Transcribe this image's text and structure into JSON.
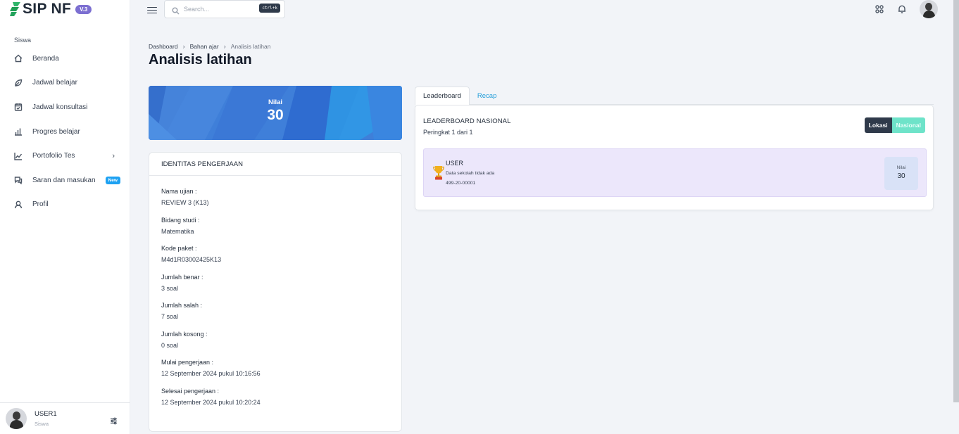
{
  "app": {
    "name": "SIP NF",
    "version_badge": "V.3"
  },
  "sidebar": {
    "section_label": "Siswa",
    "items": [
      {
        "label": "Beranda",
        "icon": "home-icon"
      },
      {
        "label": "Jadwal belajar",
        "icon": "leaf-icon"
      },
      {
        "label": "Jadwal konsultasi",
        "icon": "calendar-check-icon"
      },
      {
        "label": "Progres belajar",
        "icon": "bar-chart-icon"
      },
      {
        "label": "Portofolio Tes",
        "icon": "line-chart-icon",
        "chevron": "›"
      },
      {
        "label": "Saran dan masukan",
        "icon": "chat-icon",
        "badge": "New"
      },
      {
        "label": "Profil",
        "icon": "user-icon"
      }
    ],
    "footer": {
      "user_name": "USER1",
      "user_role": "Siswa"
    }
  },
  "topbar": {
    "search_placeholder": "Search...",
    "shortcut": "ctrl+k"
  },
  "breadcrumb": {
    "items": [
      "Dashboard",
      "Bahan ajar",
      "Analisis latihan"
    ],
    "separator": "›"
  },
  "page_title": "Analisis latihan",
  "score": {
    "label": "Nilai",
    "value": "30"
  },
  "identity": {
    "header": "IDENTITAS PENGERJAAN",
    "fields": [
      {
        "label": "Nama ujian :",
        "value": "REVIEW 3 (K13)"
      },
      {
        "label": "Bidang studi :",
        "value": "Matematika"
      },
      {
        "label": "Kode paket :",
        "value": "M4d1R03002425K13"
      },
      {
        "label": "Jumlah benar :",
        "value": "3 soal"
      },
      {
        "label": "Jumlah salah :",
        "value": "7 soal"
      },
      {
        "label": "Jumlah kosong :",
        "value": "0 soal"
      },
      {
        "label": "Mulai pengerjaan :",
        "value": "12 September 2024 pukul 10:16:56"
      },
      {
        "label": "Selesai pengerjaan :",
        "value": "12 September 2024 pukul 10:20:24"
      }
    ]
  },
  "tabs": [
    {
      "label": "Leaderboard",
      "active": true
    },
    {
      "label": "Recap",
      "active": false
    }
  ],
  "leaderboard": {
    "title": "LEADERBOARD NASIONAL",
    "rank_text": "Peringkat 1 dari 1",
    "filter_buttons": [
      "Lokasi",
      "Nasional"
    ],
    "entry": {
      "name": "USER",
      "school": "Data sekolah tidak ada",
      "id": "499-20-00001",
      "score_label": "Nilai",
      "score_value": "30"
    }
  },
  "colors": {
    "accent_blue": "#3d7bd8",
    "tab_link": "#1d9bd8",
    "lokasi_bg": "#2f3a4a",
    "nasional_bg": "#6ee3c9",
    "row_bg": "#ece7fb",
    "badge_new": "#1da1f2",
    "version_badge": "#7c6fd1"
  }
}
